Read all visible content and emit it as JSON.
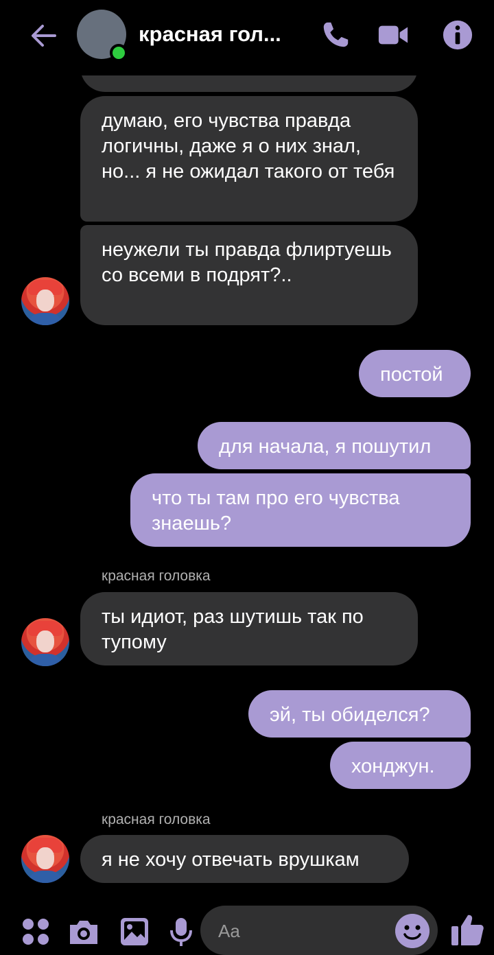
{
  "header": {
    "title": "красная гол...",
    "status": "online",
    "back_icon": "arrow-left-icon",
    "call_icon": "phone-icon",
    "video_icon": "video-camera-icon",
    "info_icon": "info-icon"
  },
  "colors": {
    "accent": "#a99ad3",
    "incoming_bubble": "#333334",
    "background": "#000000",
    "online": "#2ecc3f"
  },
  "messages": {
    "m1": "думаю, его чувства правда логичны, даже я о них знал, но... я не ожидал такого от тебя",
    "m2": "неужели ты правда флиртуешь со всеми в подрят?..",
    "m3": "постой",
    "m4": "для начала, я пошутил",
    "m5": "что ты там про его чувства знаешь?",
    "sender_a": "красная головка",
    "m6": "ты идиот, раз шутишь так по тупому",
    "m7": "эй, ты обиделся?",
    "m8": "хонджун.",
    "sender_b": "красная головка",
    "m9": "я не хочу отвечать врушкам"
  },
  "composer": {
    "placeholder": "Aa",
    "icons": [
      "apps-icon",
      "camera-icon",
      "gallery-icon",
      "microphone-icon",
      "emoji-icon",
      "thumbs-up-icon"
    ]
  }
}
